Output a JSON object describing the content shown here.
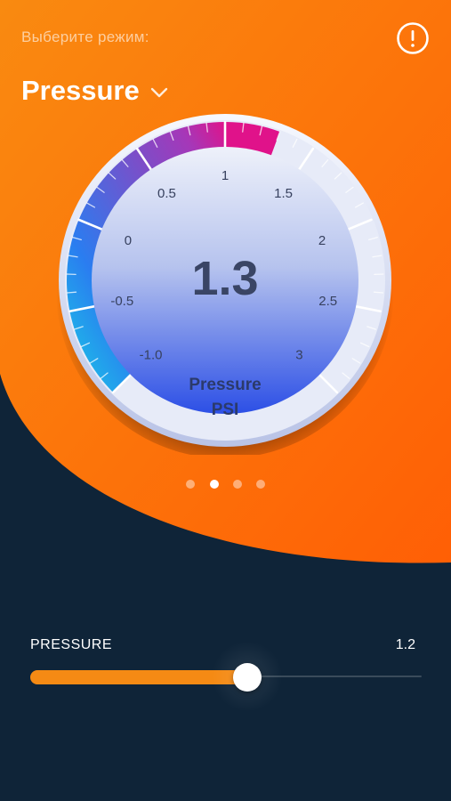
{
  "header": {
    "mode_prompt": "Выберите режим:",
    "mode_label": "Pressure",
    "info_icon": "alert-circle-icon",
    "dropdown_icon": "chevron-down-icon"
  },
  "gauge": {
    "value": "1.3",
    "value_number": 1.3,
    "label": "Pressure",
    "unit": "PSI",
    "scale_labels": [
      "-1.0",
      "-0.5",
      "0",
      "0.5",
      "1",
      "1.5",
      "2",
      "2.5",
      "3"
    ],
    "scale_min": -1.0,
    "scale_max": 3.0,
    "colors": {
      "face_top": "#e9edf8",
      "face_bottom": "#2f52e6",
      "bezel": "#eef1fb",
      "arc_cyan": "#19cde6",
      "arc_blue": "#2a7df0",
      "arc_purple": "#a637b8",
      "arc_magenta": "#e0128a"
    }
  },
  "pager": {
    "count": 4,
    "active_index": 1
  },
  "slider": {
    "label": "PRESSURE",
    "value": "1.2",
    "fraction": 0.555
  },
  "colors": {
    "orange_top": "#f98a10",
    "orange_bottom": "#ff5f05",
    "navy": "#0f2438",
    "accent": "#f58a14"
  }
}
